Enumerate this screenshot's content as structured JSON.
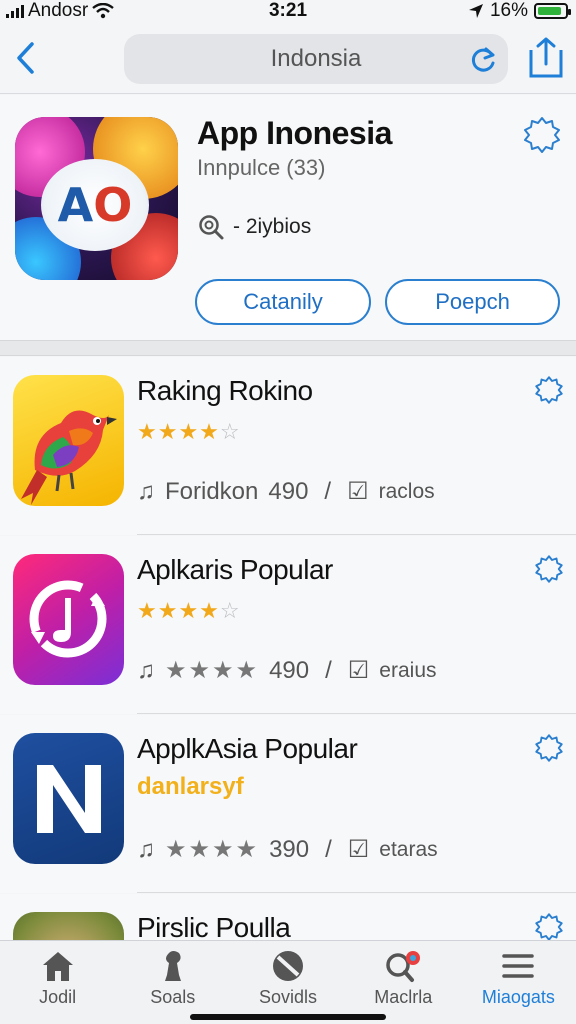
{
  "status": {
    "carrier": "Andosr",
    "time": "3:21",
    "battery": "16%",
    "battery_level": 0.16
  },
  "nav": {
    "search_query": "Indonsia"
  },
  "featured": {
    "title": "App Inonesia",
    "subtitle": "Innpulce (33)",
    "meta": "- 2iybios",
    "button_primary": "Catanily",
    "button_secondary": "Poepch",
    "icon_text": {
      "a": "A",
      "b": "O"
    }
  },
  "apps": [
    {
      "name": "Raking Rokino",
      "stars": "★★★★",
      "stars_empty": "☆",
      "rating": 4.5,
      "meta_label": "Foridkon",
      "count": "490",
      "action": "raclos"
    },
    {
      "name": "Aplkaris Popular",
      "stars": "★★★★",
      "stars_empty": "☆",
      "rating": 4.5,
      "meta_label": "★★★★",
      "count": "490",
      "action": "eraius"
    },
    {
      "name": "ApplkAsia Popular",
      "developer": "danlarsyf",
      "meta_label": "★★★★",
      "count": "390",
      "action": "etaras"
    },
    {
      "name": "Pirslic Poulla"
    }
  ],
  "tabs": [
    {
      "label": "Jodil",
      "icon": "home-icon"
    },
    {
      "label": "Soals",
      "icon": "chess-icon"
    },
    {
      "label": "Sovidls",
      "icon": "disc-icon"
    },
    {
      "label": "Maclrla",
      "icon": "search-icon"
    },
    {
      "label": "Miaogats",
      "icon": "menu-icon",
      "active": true
    }
  ],
  "colors": {
    "accent": "#1e7fd8",
    "star": "#f2a81b",
    "developer": "#f2b01b"
  }
}
